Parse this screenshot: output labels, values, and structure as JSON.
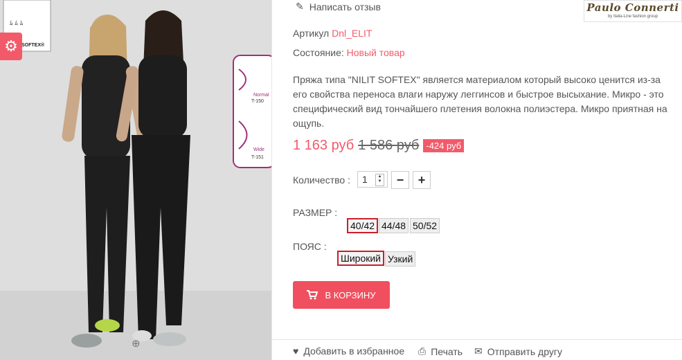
{
  "product": {
    "review_link": "Написать отзыв",
    "sku_label": "Артикул",
    "sku_value": "Dnl_ELIT",
    "condition_label": "Состояние:",
    "condition_value": "Новый товар",
    "description": "Пряжа типа \"NILIT SOFTEX\" является материалом который высоко ценится из-за его свойства переноса влаги наружу леггинсов и быстрое высыхание. Микро - это специфический вид тончайшего плетения волокна полиэстера. Микро приятная на ощупь."
  },
  "brand": {
    "name": "Paulo Connerti",
    "tagline": "by Italia-Line fashion group"
  },
  "price": {
    "current": "1 163 руб",
    "old": "1 586 руб",
    "discount": "-424 руб"
  },
  "quantity": {
    "label": "Количество :",
    "value": "1"
  },
  "size": {
    "label": "РАЗМЕР :",
    "options": [
      "40/42",
      "44/48",
      "50/52"
    ],
    "selected": "40/42"
  },
  "belt": {
    "label": "ПОЯС :",
    "options": [
      "Широкий",
      "Узкий"
    ],
    "selected": "Широкий"
  },
  "cart_button": "В КОРЗИНУ",
  "actions": {
    "wishlist": "Добавить в избранное",
    "print": "Печать",
    "send": "Отправить другу"
  },
  "photo_labels": {
    "softex": "SOFTEX®",
    "normal": "Normal",
    "normal_code": "T-150",
    "wide": "Wide",
    "wide_code": "T-151"
  },
  "colors": {
    "accent": "#f25a6a",
    "selected_border": "#cc1f2a"
  },
  "icons": [
    "gear-icon",
    "pencil-icon",
    "zoom-icon",
    "cart-icon",
    "heart-icon",
    "print-icon",
    "envelope-icon"
  ]
}
